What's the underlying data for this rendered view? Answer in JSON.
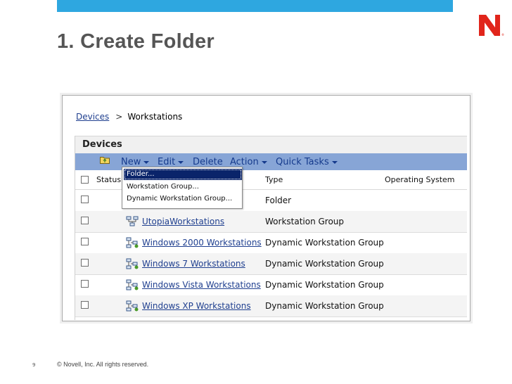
{
  "slide": {
    "title": "1. Create Folder",
    "footer": "© Novell, Inc.  All rights reserved.",
    "page_number": "9"
  },
  "breadcrumb": {
    "root": "Devices",
    "separator": ">",
    "current": "Workstations"
  },
  "panel": {
    "title": "Devices"
  },
  "toolbar": {
    "new": "New",
    "edit": "Edit",
    "delete": "Delete",
    "action": "Action",
    "quick_tasks": "Quick Tasks"
  },
  "new_menu": {
    "items": [
      "Folder...",
      "Workstation Group...",
      "Dynamic Workstation Group..."
    ],
    "selected": "Folder..."
  },
  "table": {
    "columns": {
      "status": "Status",
      "type": "Type",
      "os": "Operating System"
    },
    "rows": [
      {
        "name": "",
        "type": "Folder",
        "icon": "folder-icon"
      },
      {
        "name": "UtopiaWorkstations",
        "type": "Workstation Group",
        "icon": "workstation-group-icon"
      },
      {
        "name": "Windows 2000 Workstations",
        "type": "Dynamic Workstation Group",
        "icon": "dynamic-group-icon"
      },
      {
        "name": "Windows 7 Workstations",
        "type": "Dynamic Workstation Group",
        "icon": "dynamic-group-icon"
      },
      {
        "name": "Windows Vista Workstations",
        "type": "Dynamic Workstation Group",
        "icon": "dynamic-group-icon"
      },
      {
        "name": "Windows XP Workstations",
        "type": "Dynamic Workstation Group",
        "icon": "dynamic-group-icon"
      }
    ]
  },
  "colors": {
    "brand_red": "#e1251b",
    "top_bar": "#2ea7e0",
    "toolbar": "#87a5d6",
    "link": "#1f3f8f",
    "menu_highlight": "#0a246a"
  }
}
